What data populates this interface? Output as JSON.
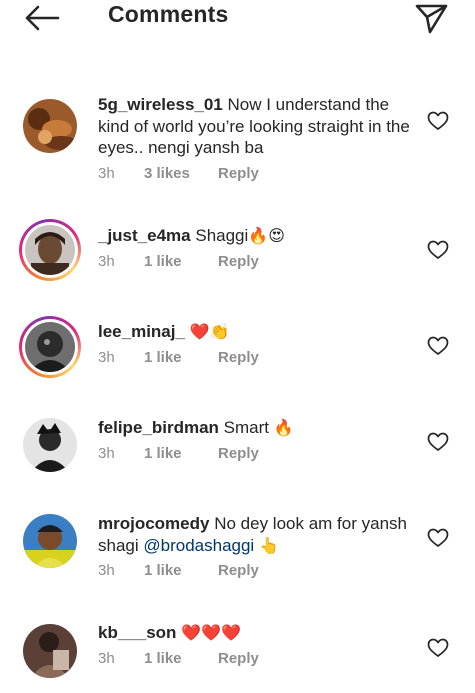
{
  "header": {
    "title": "Comments",
    "back_icon": "arrow-left-icon",
    "send_icon": "paper-plane-icon"
  },
  "colors": {
    "text": "#262626",
    "secondary": "#8e8e8e",
    "mention": "#00376b",
    "heart_emoji": "#e0245e",
    "fire": "#f4900c"
  },
  "comments": [
    {
      "username": "5g_wireless_01",
      "text": "Now I understand the kind of world you’re looking straight in the eyes.. nengi yansh ba",
      "time": "3h",
      "likes": "3 likes",
      "reply": "Reply",
      "story_ring": false
    },
    {
      "username": "_just_e4ma",
      "text": "Shaggi",
      "emojis": "🔥😍",
      "time": "3h",
      "likes": "1 like",
      "reply": "Reply",
      "story_ring": true
    },
    {
      "username": "lee_minaj_",
      "text": "",
      "emojis": "❤️👏",
      "time": "3h",
      "likes": "1 like",
      "reply": "Reply",
      "story_ring": true
    },
    {
      "username": "felipe_birdman",
      "text": "Smart",
      "emojis": "🔥",
      "time": "3h",
      "likes": "1 like",
      "reply": "Reply",
      "story_ring": false
    },
    {
      "username": "mrojocomedy",
      "text": "No dey look am for yansh shagi",
      "mention": "@brodashaggi",
      "emojis": "👆",
      "time": "3h",
      "likes": "1 like",
      "reply": "Reply",
      "story_ring": false
    },
    {
      "username": "kb___son",
      "text": "",
      "emojis": "❤️❤️❤️",
      "time": "3h",
      "likes": "1 like",
      "reply": "Reply",
      "story_ring": false
    }
  ]
}
